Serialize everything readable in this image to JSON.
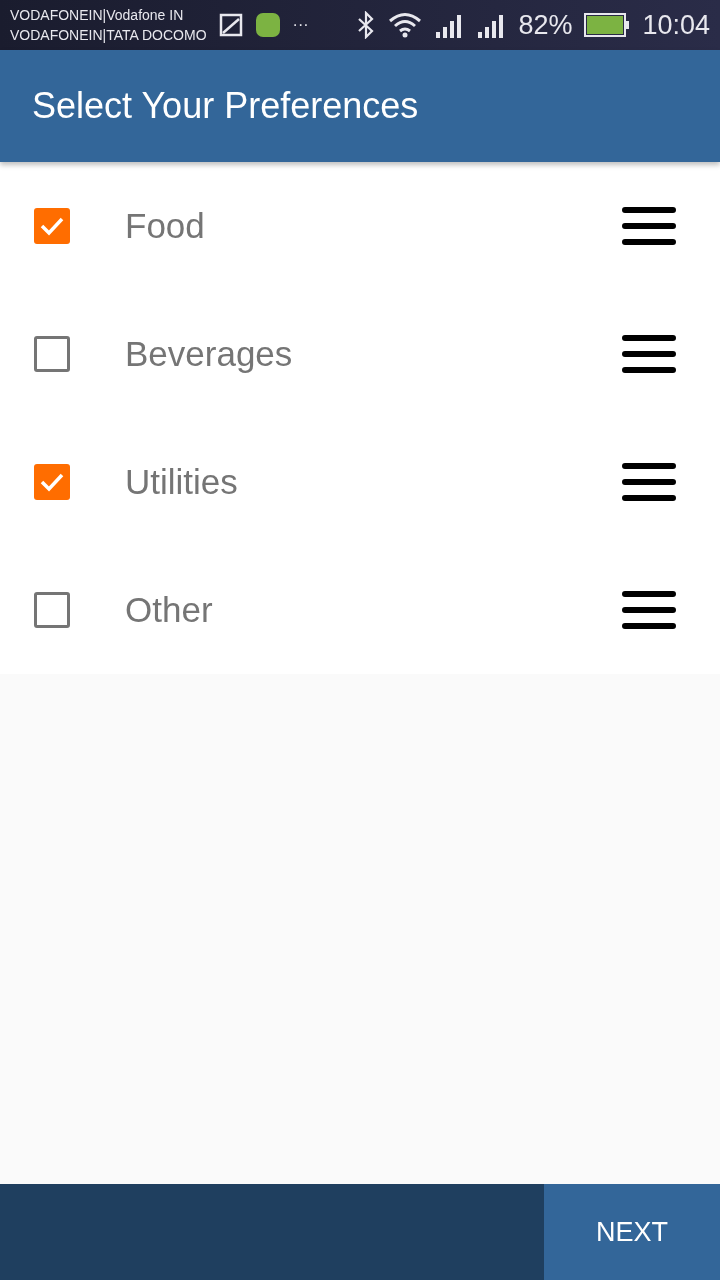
{
  "status_bar": {
    "carriers": [
      "VODAFONEIN|Vodafone IN",
      "VODAFONEIN|TATA DOCOMO"
    ],
    "overflow": "···",
    "battery_percent": "82%",
    "time": "10:04"
  },
  "app_bar": {
    "title": "Select Your Preferences"
  },
  "preferences": [
    {
      "label": "Food",
      "checked": true
    },
    {
      "label": "Beverages",
      "checked": false
    },
    {
      "label": "Utilities",
      "checked": true
    },
    {
      "label": "Other",
      "checked": false
    }
  ],
  "bottom_bar": {
    "next_button": "NEXT"
  }
}
